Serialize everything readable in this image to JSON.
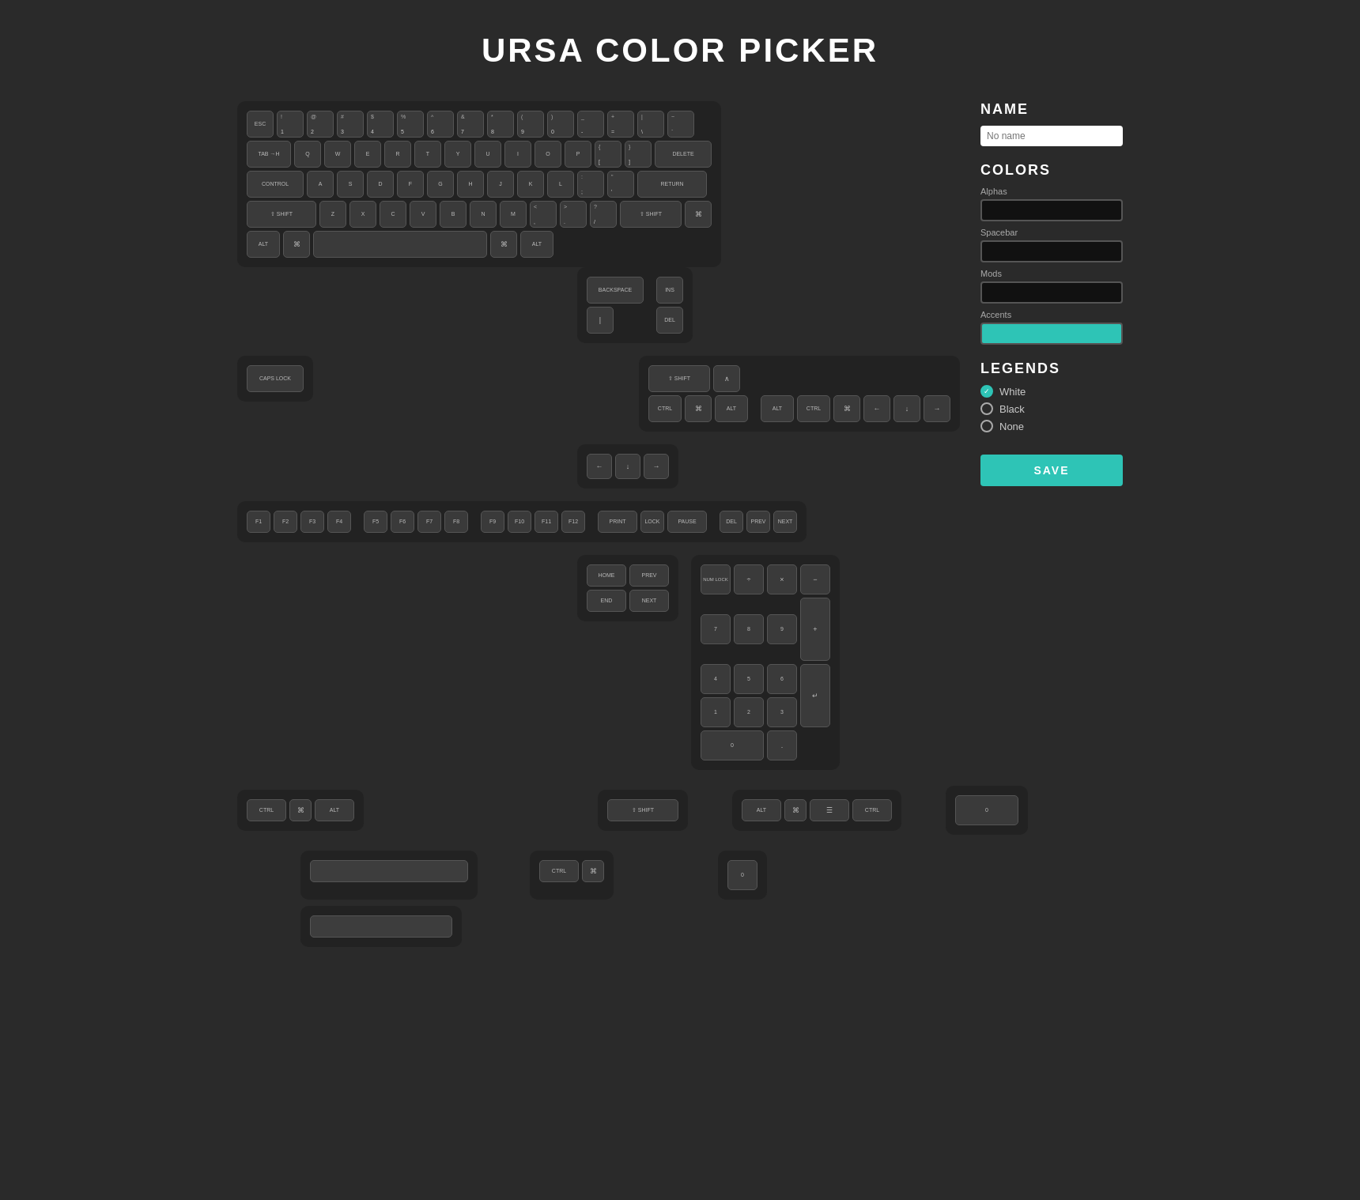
{
  "title": "URSA COLOR PICKER",
  "sidebar": {
    "name_section": "NAME",
    "name_placeholder": "No name",
    "colors_section": "COLORS",
    "alphas_label": "Alphas",
    "spacebar_label": "Spacebar",
    "mods_label": "Mods",
    "accents_label": "Accents",
    "legends_section": "LEGENDS",
    "legend_white": "White",
    "legend_black": "Black",
    "legend_none": "None",
    "save_label": "SAVE"
  },
  "keyboard": {
    "main_keys": {
      "row1": [
        "ESC",
        "1\n!",
        "2\n@",
        "3\n#",
        "4\n$",
        "5\n%",
        "6\n^",
        "7\n&",
        "8\n*",
        "9\n(",
        "0\n)",
        "-\n_",
        "=\n+",
        "\\\n|",
        "~\n`"
      ],
      "row2": [
        "TAB →H",
        "Q",
        "W",
        "E",
        "R",
        "T",
        "Y",
        "U",
        "I",
        "O",
        "P",
        "{\n[",
        "}\n]",
        "DELETE"
      ],
      "row3": [
        "CONTROL",
        "A",
        "S",
        "D",
        "F",
        "G",
        "H",
        "J",
        "K",
        "L",
        ";\n:",
        "'\n\"",
        "RETURN"
      ],
      "row4": [
        "⇧ SHIFT",
        "Z",
        "X",
        "C",
        "V",
        "B",
        "N",
        "M",
        "<\n,",
        ">\n.",
        "?\n/",
        "⇧ SHIFT",
        "⌘"
      ],
      "row5": [
        "ALT",
        "⌘",
        "",
        "⌘",
        "ALT"
      ]
    }
  }
}
